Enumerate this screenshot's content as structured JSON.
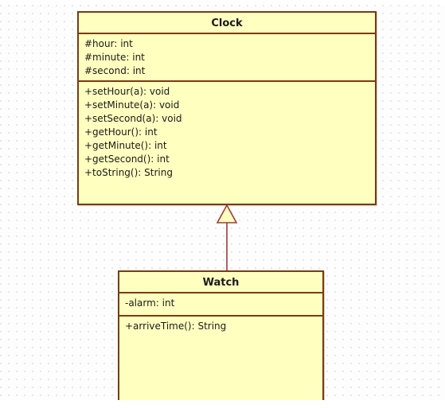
{
  "diagram": {
    "type": "uml-class-diagram",
    "canvas": {
      "background_color": "#fdfdfd",
      "grid": "dotted",
      "grid_spacing_px": 10,
      "grid_dot_color": "#e2e2e8"
    },
    "style": {
      "class_fill": "#ffffc0",
      "class_border": "#7a3b10",
      "connector_color": "#a03c3c",
      "text_color": "#1a1a1a"
    },
    "classes": [
      {
        "id": "clock",
        "name": "Clock",
        "attributes": [
          "#hour: int",
          "#minute: int",
          "#second: int"
        ],
        "operations": [
          "+setHour(a): void",
          "+setMinute(a): void",
          "+setSecond(a): void",
          "+getHour(): int",
          "+getMinute(): int",
          "+getSecond(): int",
          "+toString(): String"
        ]
      },
      {
        "id": "watch",
        "name": "Watch",
        "attributes": [
          "-alarm: int"
        ],
        "operations": [
          "+arriveTime(): String"
        ]
      }
    ],
    "relationships": [
      {
        "type": "generalization",
        "from": "Watch",
        "to": "Clock",
        "arrow": "hollow-triangle"
      }
    ]
  }
}
